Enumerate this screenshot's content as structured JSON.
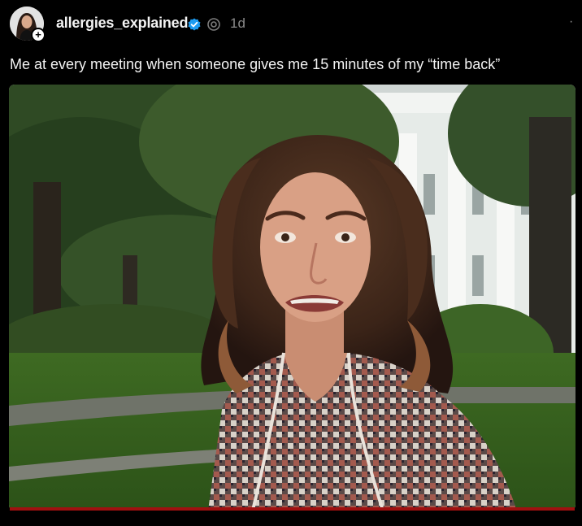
{
  "post": {
    "username": "allergies_explained",
    "time": "1d",
    "more_icon": "·",
    "caption": "Me at every meeting when someone gives me 15 minutes of my “time back”",
    "icons": {
      "avatar": "avatar",
      "follow": "plus-icon",
      "verified": "verified-badge-icon",
      "threads": "threads-icon"
    }
  },
  "media": {
    "kind": "video-still",
    "accent_color": "#a01010"
  }
}
